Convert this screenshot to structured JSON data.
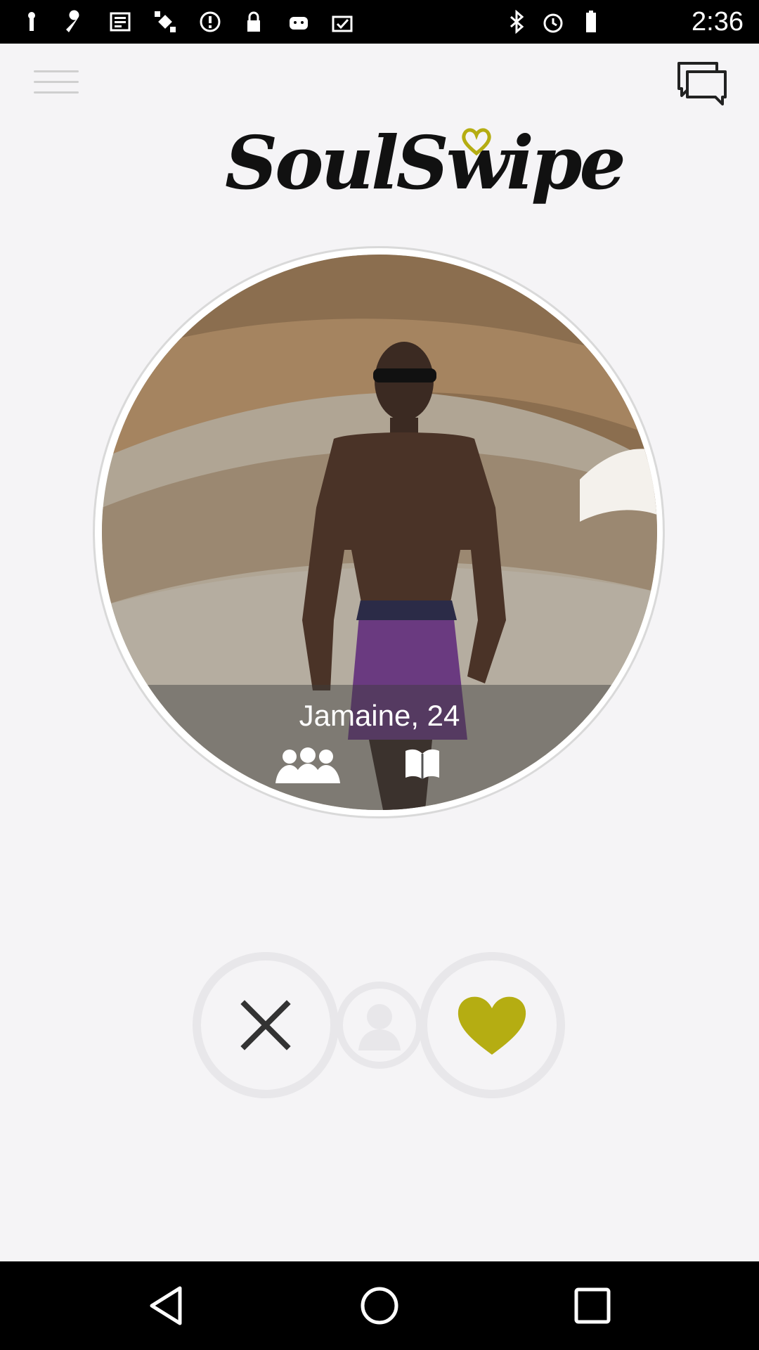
{
  "status_bar": {
    "time": "2:36",
    "left_icons": [
      "notification-icon",
      "wrench-icon",
      "news-icon",
      "fake-gps-icon",
      "data-saver-icon",
      "lock-icon",
      "android-icon",
      "task-icon"
    ],
    "right_icons": [
      "bluetooth-icon",
      "alarm-icon",
      "battery-icon"
    ]
  },
  "header": {
    "logo_text": "SoulSwipe",
    "menu_icon": "hamburger-menu-icon",
    "chat_icon": "chat-icon"
  },
  "profile": {
    "name_age": "Jamaine, 24",
    "icons": [
      "friends-icon",
      "book-icon"
    ]
  },
  "actions": {
    "dislike_icon": "close-icon",
    "profile_icon": "person-icon",
    "like_icon": "heart-icon"
  },
  "colors": {
    "accent": "#b5ad12",
    "background": "#f5f4f6"
  },
  "nav_bar": {
    "icons": [
      "back-icon",
      "home-icon",
      "recents-icon"
    ]
  }
}
